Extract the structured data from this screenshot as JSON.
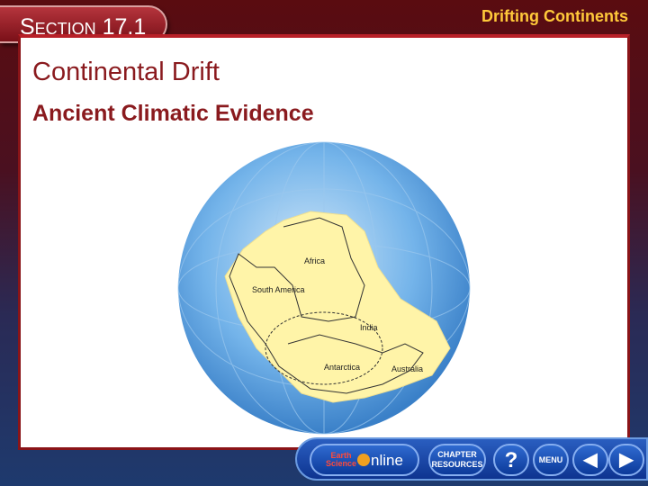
{
  "header": {
    "section": "Section 17.1",
    "topic": "Drifting Continents"
  },
  "slide": {
    "title": "Continental Drift",
    "subtitle": "Ancient Climatic Evidence"
  },
  "map": {
    "labels": {
      "africa": "Africa",
      "south_america": "South America",
      "india": "India",
      "antarctica": "Antarctica",
      "australia": "Australia"
    }
  },
  "nav": {
    "online_earth": "Earth",
    "online_science": "Science",
    "online_suffix": "nline",
    "chapter": "CHAPTER",
    "resources": "RESOURCES",
    "help": "?",
    "menu": "MENU"
  },
  "colors": {
    "accent": "#8a1a1e",
    "topic": "#ffc93a",
    "globe": "#6aaee8",
    "land": "#fff4a8"
  }
}
